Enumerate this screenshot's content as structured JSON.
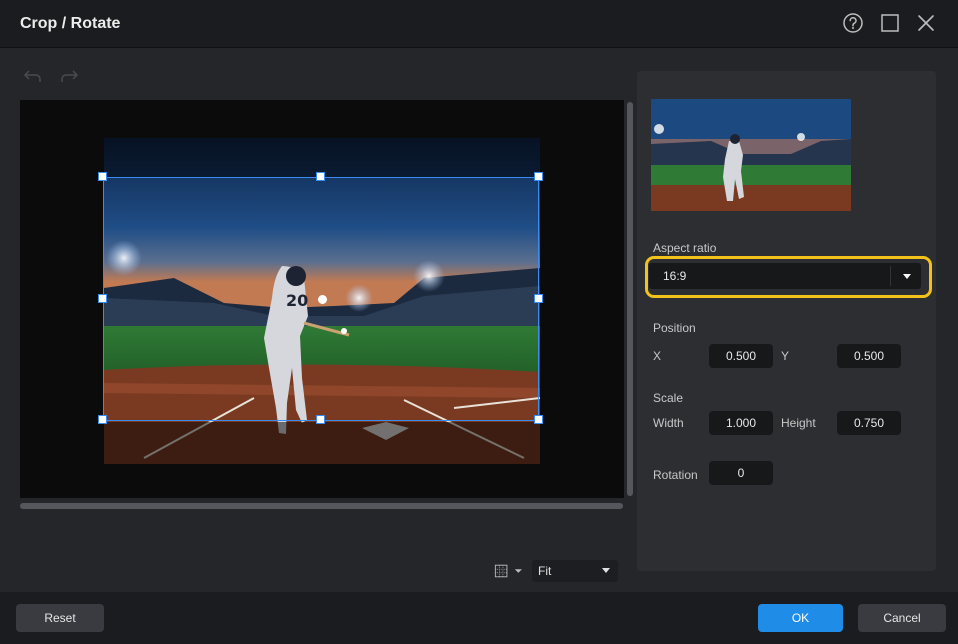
{
  "window": {
    "title": "Crop / Rotate"
  },
  "zoom": {
    "selected": "Fit"
  },
  "panel": {
    "aspect_ratio": {
      "label": "Aspect ratio",
      "value": "16:9"
    },
    "position": {
      "label": "Position",
      "x_label": "X",
      "x_value": "0.500",
      "y_label": "Y",
      "y_value": "0.500"
    },
    "scale": {
      "label": "Scale",
      "width_label": "Width",
      "width_value": "1.000",
      "height_label": "Height",
      "height_value": "0.750"
    },
    "rotation": {
      "label": "Rotation",
      "value": "0"
    }
  },
  "footer": {
    "reset_label": "Reset",
    "ok_label": "OK",
    "cancel_label": "Cancel"
  },
  "photo": {
    "jersey_number": "20"
  },
  "colors": {
    "accent": "#1f8de8",
    "crop_border": "#3b8cf0",
    "highlight": "#f3c21a"
  }
}
